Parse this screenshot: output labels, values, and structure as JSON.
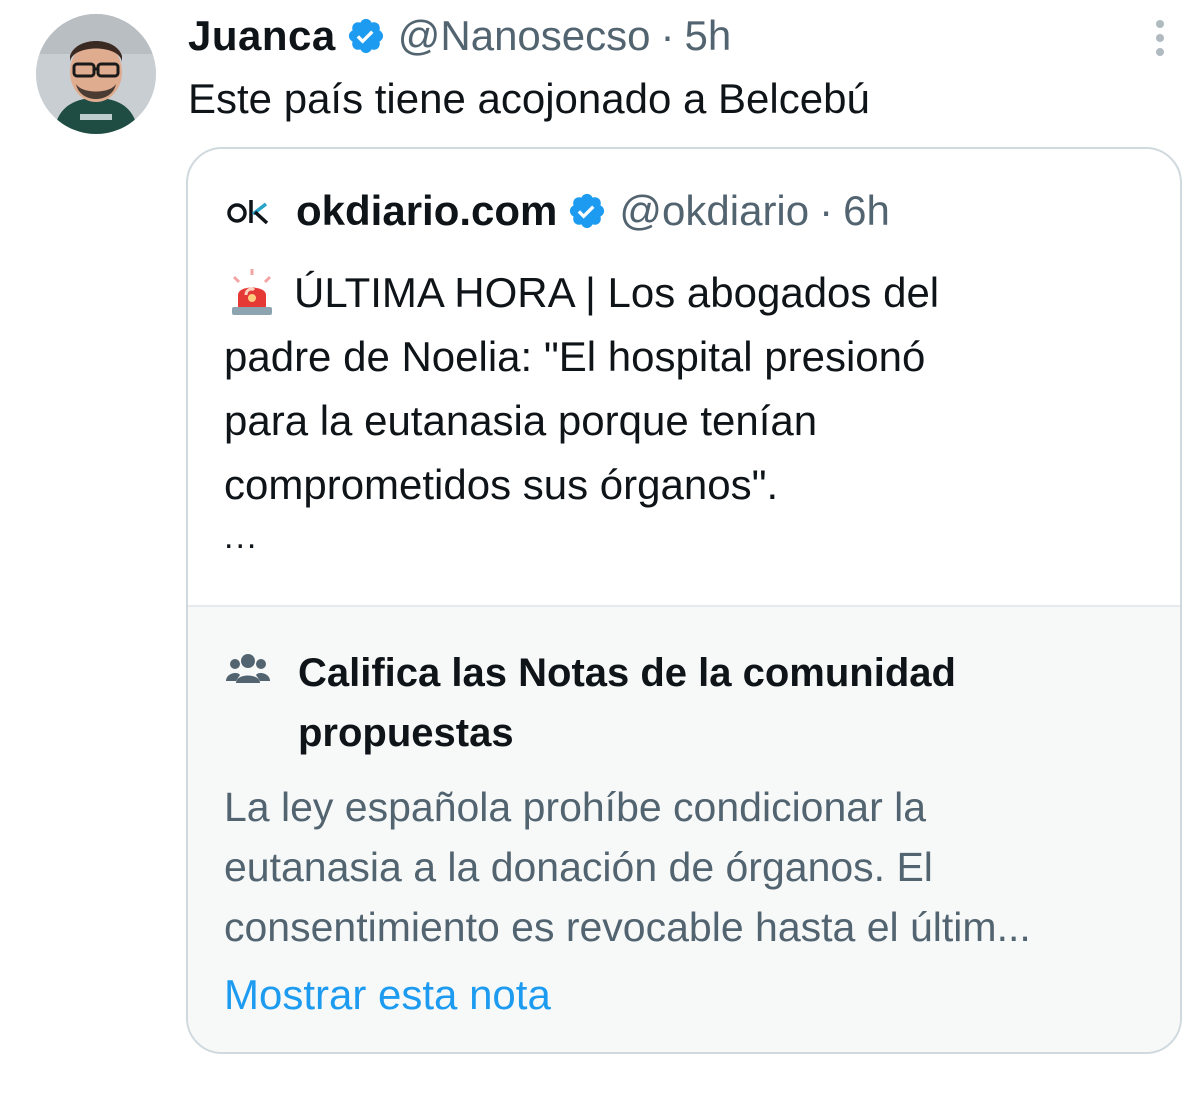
{
  "tweet": {
    "author_name": "Juanca",
    "author_handle": "@Nanosecso",
    "separator": "·",
    "time": "5h",
    "text": "Este país tiene acojonado a Belcebú",
    "verified_color": "#1d9bf0"
  },
  "quoted": {
    "logo_text": "ok",
    "author_name": "okdiario.com",
    "author_handle": "@okdiario",
    "separator": "·",
    "time": "6h",
    "lines": [
      "ÚLTIMA HORA | Los abogados del",
      "padre de Noelia: \"El hospital presionó",
      "para la eutanasia porque tenían",
      "comprometidos sus órganos\"."
    ],
    "ellipsis": "..."
  },
  "community_notes": {
    "title": "Califica las Notas de la comunidad propuestas",
    "text_lines": [
      "La ley española prohíbe condicionar la",
      "eutanasia a la donación de órganos. El",
      "consentimiento es revocable hasta el últim..."
    ],
    "link": "Mostrar esta nota",
    "link_color": "#1d9bf0"
  },
  "icons": {
    "more": "vertical-ellipsis-icon",
    "verified": "verified-badge-icon",
    "siren": "rotating-light-emoji-icon",
    "people": "people-group-icon"
  }
}
